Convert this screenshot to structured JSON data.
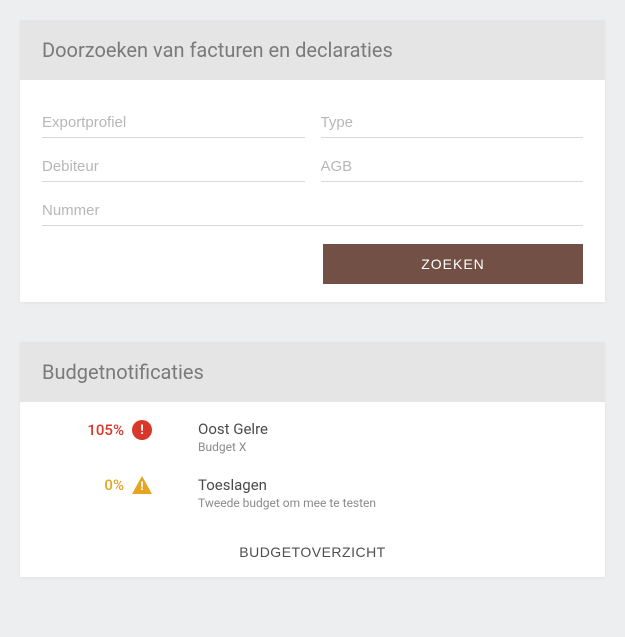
{
  "search": {
    "title": "Doorzoeken van facturen en declaraties",
    "fields": {
      "exportprofiel": "Exportprofiel",
      "type": "Type",
      "debiteur": "Debiteur",
      "agb": "AGB",
      "nummer": "Nummer"
    },
    "submit_label": "ZOEKEN"
  },
  "notifications": {
    "title": "Budgetnotificaties",
    "items": [
      {
        "percent": "105%",
        "status": "danger",
        "name": "Oost Gelre",
        "subtitle": "Budget X"
      },
      {
        "percent": "0%",
        "status": "warning",
        "name": "Toeslagen",
        "subtitle": "Tweede budget om mee te testen"
      }
    ],
    "overview_label": "BUDGETOVERZICHT"
  }
}
